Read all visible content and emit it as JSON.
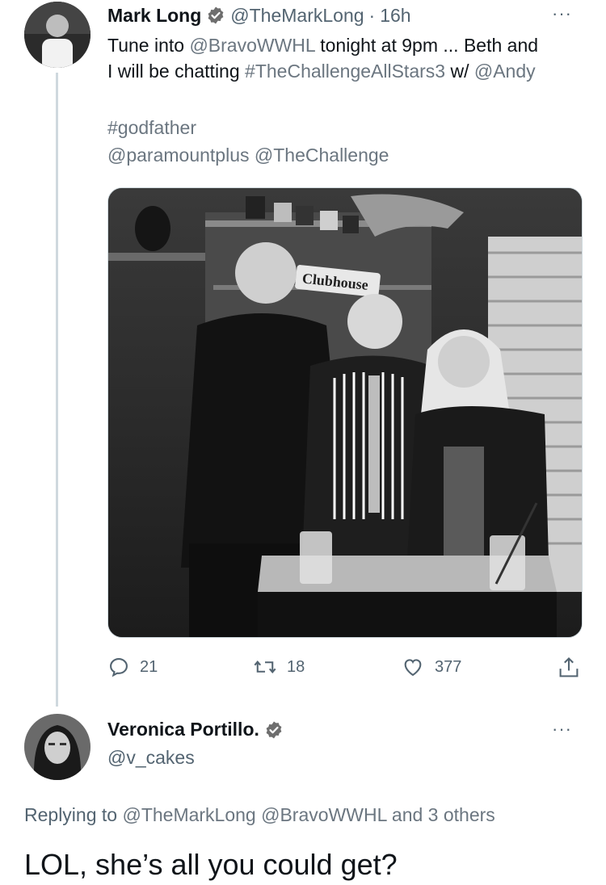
{
  "tweet": {
    "author_name": "Mark Long",
    "author_handle": "@TheMarkLong",
    "dot": "·",
    "time": "16h",
    "more": "···",
    "text": {
      "part1": "Tune into ",
      "mention_bravo": "@BravoWWHL",
      "part2": " tonight at 9pm ... Beth and",
      "part3": "I will be chatting ",
      "hashtag_challenge": "#TheChallengeAllStars3",
      "part4": " w/ ",
      "mention_andy": "@Andy",
      "hashtag_godfather": "#godfather",
      "mention_paramount": "@paramountplus",
      "mention_challenge": "@TheChallenge"
    },
    "photo_sign": "Clubhouse",
    "actions": {
      "reply_count": "21",
      "retweet_count": "18",
      "like_count": "377"
    }
  },
  "reply": {
    "author_name": "Veronica Portillo.",
    "author_handle": "@v_cakes",
    "more": "···",
    "replying_prefix": "Replying to ",
    "replying_targets": "@TheMarkLong @BravoWWHL",
    "replying_suffix": " and 3 others",
    "text": "LOL, she’s all you could get?"
  }
}
